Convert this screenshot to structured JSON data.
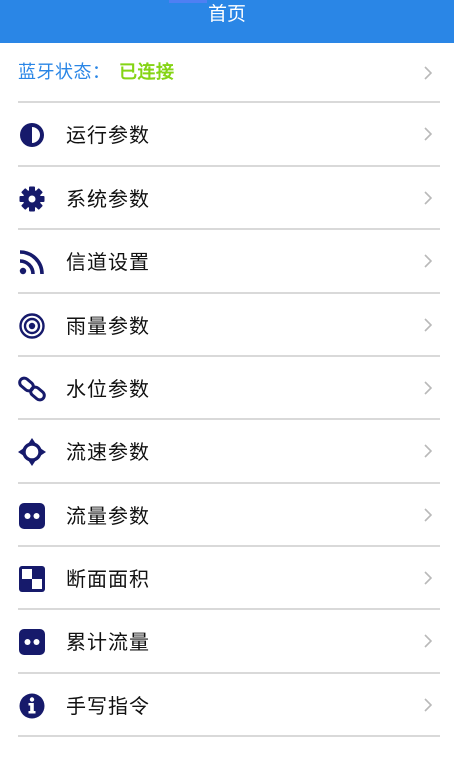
{
  "colors": {
    "header_bg": "#2a86e6",
    "icon": "#161a6b",
    "bluetooth_label": "#2a86e6",
    "bluetooth_status": "#85d415",
    "divider": "#d9d9d9",
    "chevron": "#b9b9b9"
  },
  "header": {
    "title": "首页"
  },
  "bluetooth": {
    "label": "蓝牙状态：",
    "status": "已连接"
  },
  "menu": [
    {
      "label": "运行参数",
      "icon": "half-circle-icon"
    },
    {
      "label": "系统参数",
      "icon": "gear-icon"
    },
    {
      "label": "信道设置",
      "icon": "rss-icon"
    },
    {
      "label": "雨量参数",
      "icon": "target-icon"
    },
    {
      "label": "水位参数",
      "icon": "chain-link-icon"
    },
    {
      "label": "流速参数",
      "icon": "crosshair-icon"
    },
    {
      "label": "流量参数",
      "icon": "twin-dots-icon"
    },
    {
      "label": "断面面积",
      "icon": "checker-square-icon"
    },
    {
      "label": "累计流量",
      "icon": "twin-dots-icon"
    },
    {
      "label": "手写指令",
      "icon": "info-icon"
    }
  ]
}
